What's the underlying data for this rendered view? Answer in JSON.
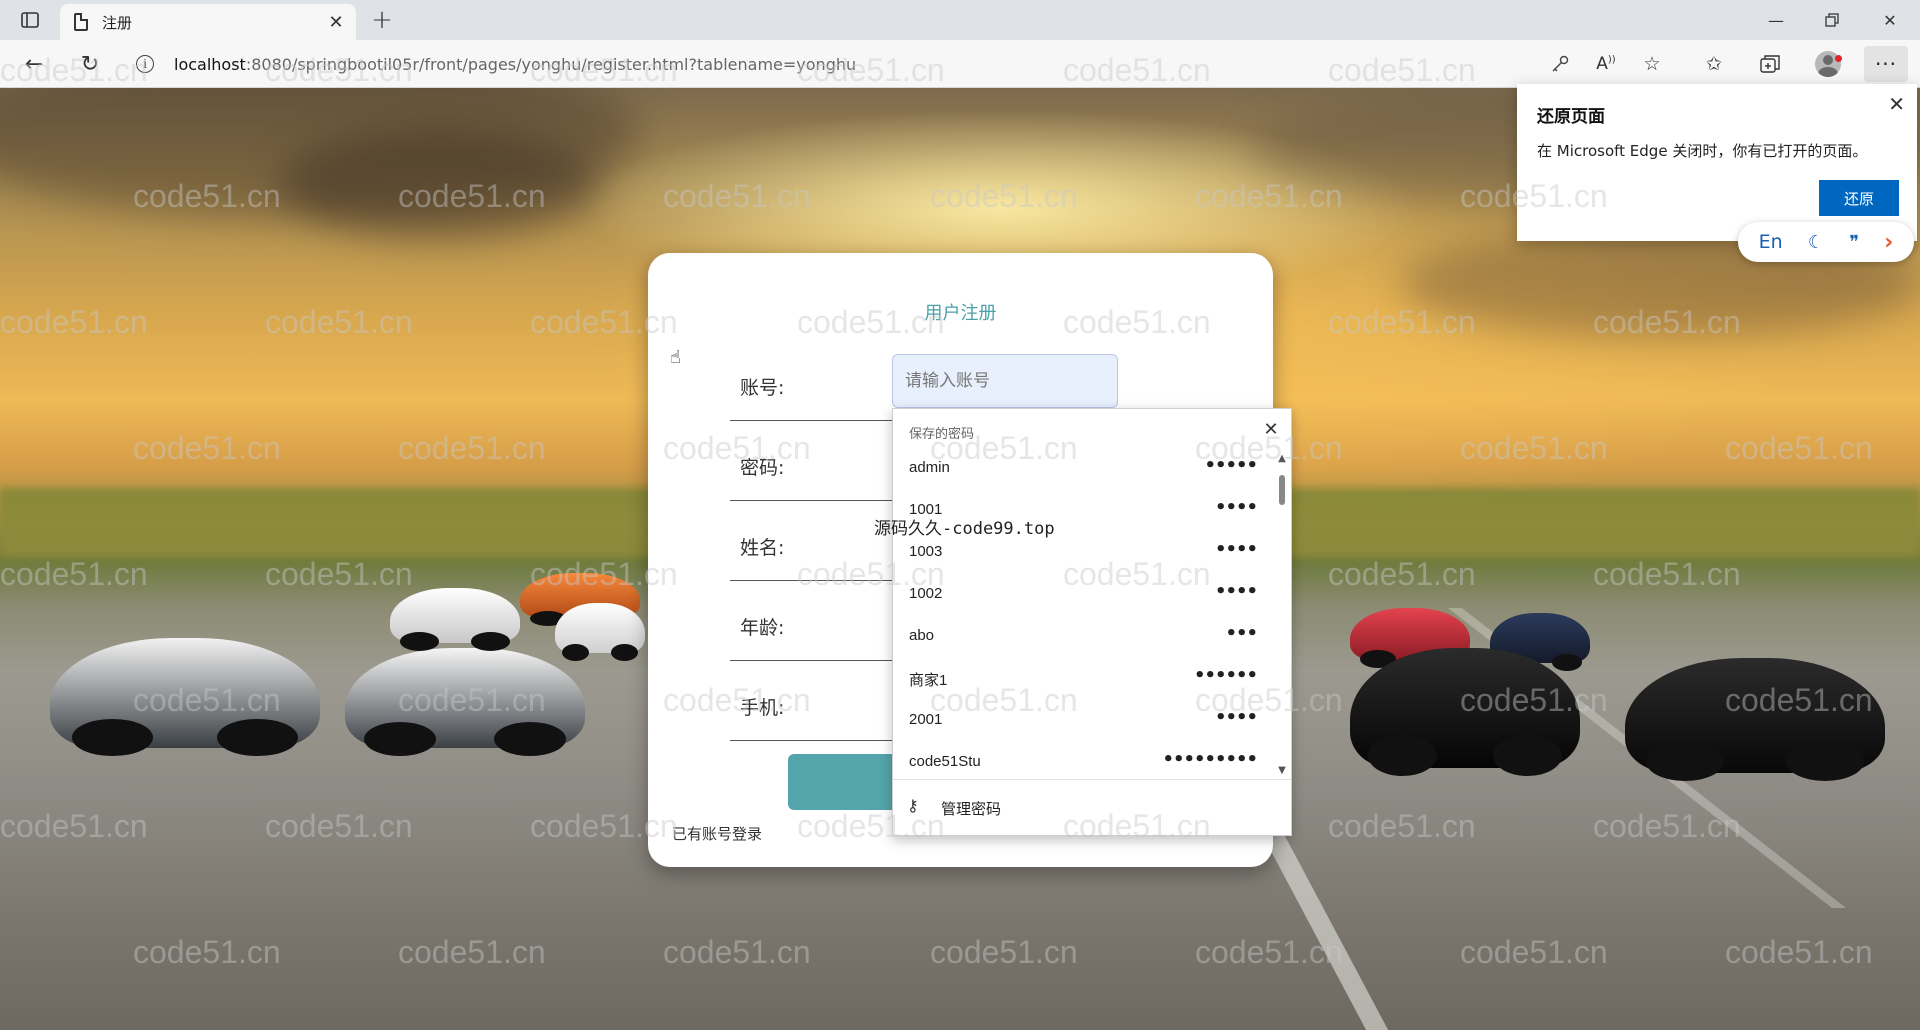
{
  "browser": {
    "tab_title": "注册",
    "url_host": "localhost",
    "url_rest": ":8080/springbootil05r/front/pages/yonghu/register.html?tablename=yonghu",
    "toolbar_icons": [
      "key-icon",
      "read-aloud-icon",
      "favorite-add-icon",
      "favorites-icon",
      "collections-icon",
      "profile-icon",
      "more-icon"
    ]
  },
  "restore_popup": {
    "title": "还原页面",
    "description": "在 Microsoft Edge 关闭时，你有已打开的页面。",
    "button_label": "还原"
  },
  "mini_toolbar": {
    "translate_label": "En"
  },
  "register": {
    "title": "用户注册",
    "fields": [
      {
        "label": "账号:"
      },
      {
        "label": "密码:"
      },
      {
        "label": "姓名:"
      },
      {
        "label": "年龄:"
      },
      {
        "label": "手机:"
      }
    ],
    "account_placeholder": "请输入账号",
    "login_link": "已有账号登录"
  },
  "password_dropdown": {
    "header": "保存的密码",
    "items": [
      {
        "user": "admin",
        "mask": "•••••"
      },
      {
        "user": "1001",
        "mask": "••••"
      },
      {
        "user": "1003",
        "mask": "••••"
      },
      {
        "user": "1002",
        "mask": "••••"
      },
      {
        "user": "abo",
        "mask": "•••"
      },
      {
        "user": "商家1",
        "mask": "••••••"
      },
      {
        "user": "2001",
        "mask": "••••"
      },
      {
        "user": "code51Stu",
        "mask": "•••••••••"
      }
    ],
    "manage_label": "管理密码"
  },
  "overlay_text": "源码久久-code99.top",
  "watermark_text": "code51.cn"
}
